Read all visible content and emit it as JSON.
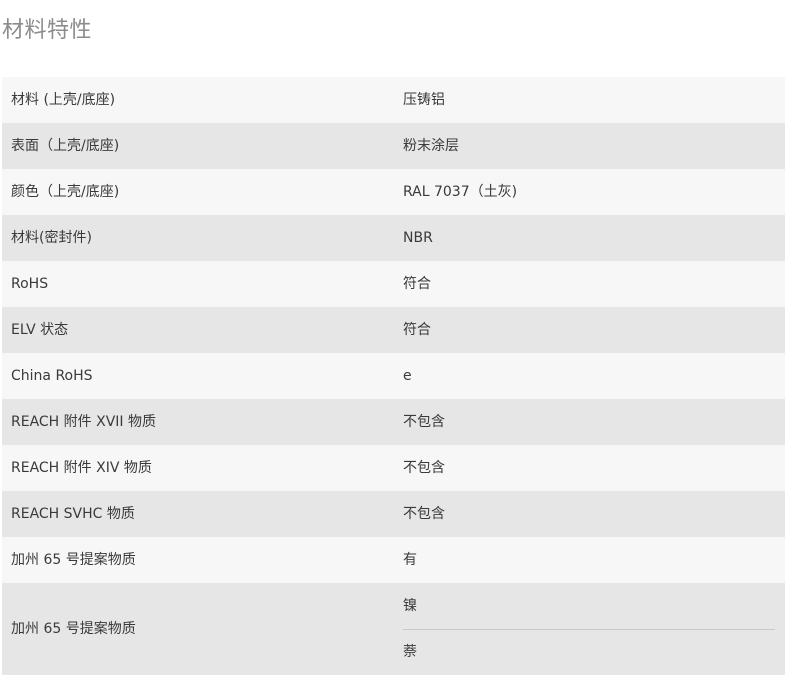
{
  "section": {
    "title": "材料特性"
  },
  "rows": [
    {
      "label": "材料 (上壳/底座)",
      "value": "压铸铝"
    },
    {
      "label": "表面（上壳/底座)",
      "value": "粉末涂层"
    },
    {
      "label": "颜色（上壳/底座)",
      "value": "RAL 7037（土灰)"
    },
    {
      "label": "材料(密封件)",
      "value": "NBR"
    },
    {
      "label": "RoHS",
      "value": "符合"
    },
    {
      "label": "ELV 状态",
      "value": "符合"
    },
    {
      "label": "China RoHS",
      "value": "e"
    },
    {
      "label": "REACH 附件 XVII 物质",
      "value": "不包含"
    },
    {
      "label": "REACH 附件 XIV 物质",
      "value": "不包含"
    },
    {
      "label": "REACH SVHC 物质",
      "value": "不包含"
    },
    {
      "label": "加州 65 号提案物质",
      "value": "有"
    },
    {
      "label": "加州 65 号提案物质",
      "values": [
        "镍",
        "萘"
      ]
    }
  ]
}
